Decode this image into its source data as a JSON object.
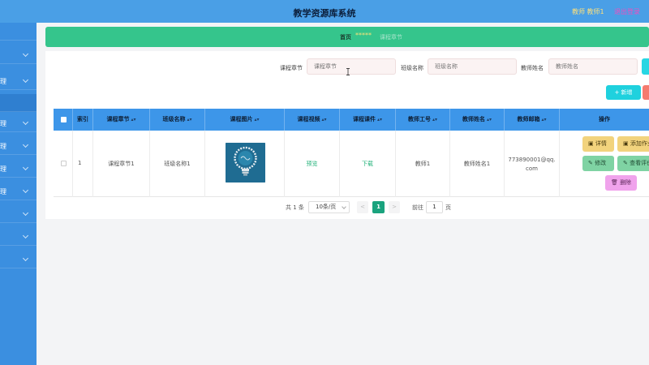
{
  "header": {
    "title": "教学资源库系统",
    "user": "教师 教师1",
    "logout": "退出登录"
  },
  "sidebar": {
    "items": [
      {
        "label": "",
        "expanded": false
      },
      {
        "label": "",
        "expanded": false
      },
      {
        "label": "理",
        "expanded": false
      },
      {
        "label": "",
        "expanded": false
      },
      {
        "label": "理",
        "expanded": false
      },
      {
        "label": "理",
        "expanded": false
      },
      {
        "label": "理",
        "expanded": false
      },
      {
        "label": "理",
        "expanded": false
      },
      {
        "label": "",
        "expanded": false
      },
      {
        "label": "",
        "expanded": false
      },
      {
        "label": "",
        "expanded": false
      }
    ]
  },
  "breadcrumb": {
    "home": "首页",
    "separator": "*****",
    "current": "课程章节"
  },
  "search": {
    "chapter_label": "课程章节",
    "chapter_placeholder": "课程章节",
    "class_label": "班级名称",
    "class_placeholder": "班级名称",
    "teacher_label": "教师姓名",
    "teacher_placeholder": "教师姓名"
  },
  "toolbar": {
    "add_label": "+ 新增"
  },
  "table": {
    "columns": [
      "索引",
      "课程章节",
      "班级名称",
      "课程图片",
      "课程视频",
      "课程课件",
      "教师工号",
      "教师姓名",
      "教师邮箱",
      "操作"
    ],
    "rows": [
      {
        "index": "1",
        "chapter": "课程章节1",
        "class_name": "班级名称1",
        "video": "预览",
        "courseware": "下载",
        "teacher_id": "教师1",
        "teacher_name": "教师姓名1",
        "email_line1": "773890001@qq.",
        "email_line2": "com",
        "actions": {
          "detail": "详情",
          "add_homework": "添加作业",
          "edit": "修改",
          "view_review": "查看评价",
          "delete": "删除"
        }
      }
    ]
  },
  "pagination": {
    "total": "共 1 条",
    "page_size": "10条/页",
    "prev": "<",
    "current_page": "1",
    "next": ">",
    "goto_label": "前往",
    "goto_value": "1",
    "page_suffix": "页"
  },
  "colors": {
    "header": "#4a9fe6",
    "sidebar": "#3b8fe0",
    "breadcrumb": "#35c58c",
    "table_header": "#3d96e9",
    "accent_cyan": "#1fd1de",
    "pager_active": "#1aa37e"
  }
}
